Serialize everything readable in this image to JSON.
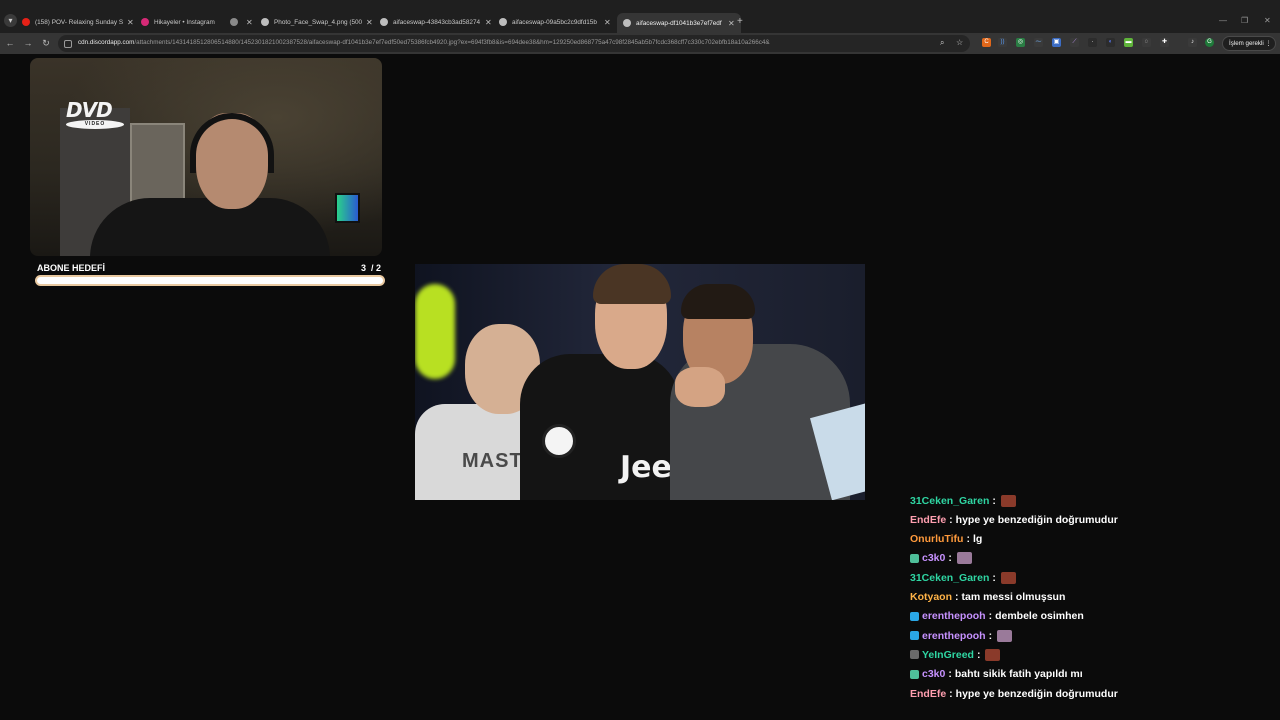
{
  "browser": {
    "tabs": [
      {
        "title": "(158) POV- Relaxing Sunday Sh",
        "favicon_color": "#e62117"
      },
      {
        "title": "Hikayeler • Instagram",
        "favicon_color": "#d62976"
      },
      {
        "title": "",
        "favicon_color": "#8a8a8a"
      },
      {
        "title": "Photo_Face_Swap_4.png (500×",
        "favicon_color": "#bdbdbd"
      },
      {
        "title": "aifaceswap-43843cb3ad58274",
        "favicon_color": "#bdbdbd"
      },
      {
        "title": "aifaceswap-09a5bc2c9dfd15b",
        "favicon_color": "#bdbdbd"
      },
      {
        "title": "aifaceswap-df1041b3e7ef7edf",
        "favicon_color": "#bdbdbd",
        "active": true
      }
    ],
    "url_host": "cdn.discordapp.com",
    "url_path": "/attachments/1431418512806514880/1452301821002387528/aifaceswap-df1041b3e7ef7edf50ed75386fcb4920.jpg?ex=694f3fb8&is=694dee38&hm=129250ed868775a47c98f2845ab5b7fcdc368cff7c330c702ebfb18a10a266c4&",
    "update_button": "İşlem gerekli"
  },
  "stream": {
    "goal_label": "ABONE HEDEFİ",
    "goal_count": "3  / 2",
    "goal_progress": 1.0,
    "dvd_logo": {
      "top": "DVD",
      "bottom": "VIDEO"
    },
    "photo_text": {
      "jersey_name": "MASTA",
      "sponsor": "Jeep"
    }
  },
  "chat": [
    {
      "user": "31Ceken_Garen",
      "color": "#2fd6a3",
      "text": "",
      "emote": true,
      "badge": null
    },
    {
      "user": "EndEfe",
      "color": "#ff9fb0",
      "text": "hype ye benzediğin doğrumudur",
      "emote": false,
      "badge": null
    },
    {
      "user": "OnurluTifu",
      "color": "#ff9a3c",
      "text": "lg",
      "emote": false,
      "badge": null
    },
    {
      "user": "c3k0",
      "color": "#c792ff",
      "text": "",
      "emote": true,
      "badge": "#4fbf9a"
    },
    {
      "user": "31Ceken_Garen",
      "color": "#2fd6a3",
      "text": "",
      "emote": true,
      "badge": null
    },
    {
      "user": "Kotyaon",
      "color": "#ffb347",
      "text": "tam messi olmuşsun",
      "emote": false,
      "badge": null
    },
    {
      "user": "erenthepooh",
      "color": "#c792ff",
      "text": "dembele osimhen",
      "emote": false,
      "badge": "#2aa7e6"
    },
    {
      "user": "erenthepooh",
      "color": "#c792ff",
      "text": "",
      "emote": true,
      "badge": "#2aa7e6"
    },
    {
      "user": "YeInGreed",
      "color": "#2fd6a3",
      "text": "",
      "emote": true,
      "badge": "#6a6a6a"
    },
    {
      "user": "c3k0",
      "color": "#c792ff",
      "text": "bahtı sikik fatih yapıldı mı",
      "emote": false,
      "badge": "#4fbf9a"
    },
    {
      "user": "EndEfe",
      "color": "#ff9fb0",
      "text": "hype ye benzediğin doğrumudur",
      "emote": false,
      "badge": null
    }
  ]
}
